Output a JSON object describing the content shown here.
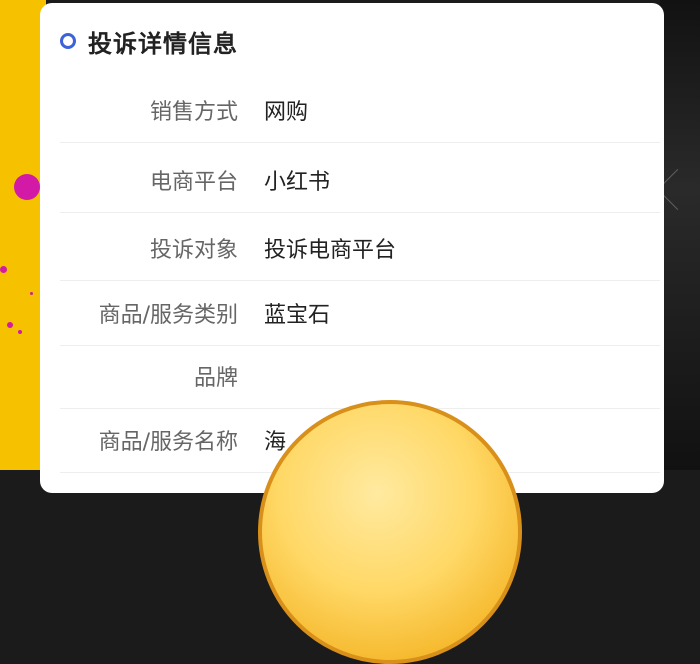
{
  "card": {
    "title": "投诉详情信息"
  },
  "rows": [
    {
      "label": "销售方式",
      "value": "网购"
    },
    {
      "label": "电商平台",
      "value": "小红书"
    },
    {
      "label": "投诉对象",
      "value": "投诉电商平台"
    },
    {
      "label": "商品/服务类别",
      "value": "蓝宝石"
    },
    {
      "label": "品牌",
      "value": ""
    },
    {
      "label": "商品/服务名称",
      "value": "海"
    }
  ],
  "colors": {
    "accent": "#3d63d8",
    "left_background": "#f6c200",
    "emoji_yellow": "#ffd866"
  }
}
